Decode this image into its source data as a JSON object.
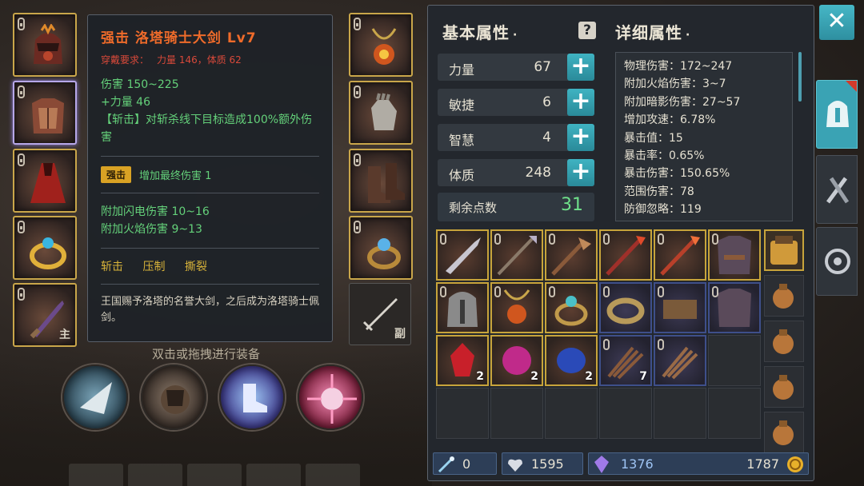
{
  "tooltip": {
    "title": "强击  洛塔骑士大剑  Lv7",
    "requirement_label": "穿戴要求：",
    "requirement_values": "力量 146，体质 62",
    "stats": [
      "伤害   150~225",
      "+力量  46",
      "【斩击】对斩杀线下目标造成100%额外伤害"
    ],
    "skill_badge": "强击",
    "skill_text": "增加最终伤害  1",
    "bonus": [
      "附加闪电伤害  10~16",
      "附加火焰伤害  9~13"
    ],
    "tags": [
      "斩击",
      "压制",
      "撕裂"
    ],
    "description": "王国赐予洛塔的名誉大剑，之后成为洛塔骑士佩剑。"
  },
  "equipment": {
    "main_label": "主",
    "offhand_label": "副"
  },
  "hint": "双击或拖拽进行装备",
  "panel": {
    "basic_title": "基本属性",
    "detail_title": "详细属性",
    "header_dot": "·",
    "help_icon": "?",
    "stats": [
      {
        "label": "力量",
        "value": "67"
      },
      {
        "label": "敏捷",
        "value": "6"
      },
      {
        "label": "智慧",
        "value": "4"
      },
      {
        "label": "体质",
        "value": "248"
      }
    ],
    "plus_glyph": "+",
    "remaining_label": "剩余点数",
    "remaining_value": "31",
    "details": [
      "物理伤害：172~247",
      "附加火焰伤害：3~7",
      "附加暗影伤害：27~57",
      "增加攻速：6.78%",
      "暴击值：15",
      "暴击率：0.65%",
      "暴击伤害：150.65%",
      "范围伤害：78",
      "防御忽略：119"
    ]
  },
  "inventory": {
    "quantities": {
      "r3c1": "2",
      "r3c2": "2",
      "r3c3": "2",
      "r3c4": "7"
    }
  },
  "currency": {
    "crystal_shards": "0",
    "hearts": "1595",
    "gems": "1376",
    "gold": "1787"
  },
  "close_glyph": "✕",
  "colors": {
    "accent": "#3aa3b4",
    "legendary_border": "#c9a64a",
    "title_orange": "#ef6b2a",
    "stat_green": "#64d17a"
  }
}
